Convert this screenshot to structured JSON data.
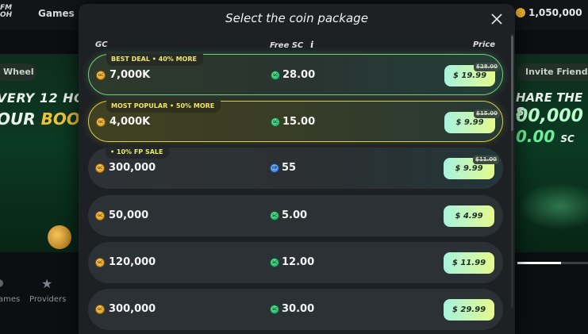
{
  "background": {
    "logo": "FM\nOH",
    "nav_games": "Games",
    "balance": "1,050,000",
    "wheel_pill": "Wheel",
    "left_line1": "VERY 12 HO",
    "left_line2a": "OUR ",
    "left_line2b": "BOOS",
    "invite_pill": "Invite Friends",
    "right_line1": "HARE THE S",
    "right_line2": "00,000",
    "right_line3": "0.00",
    "right_line3_unit": "SC",
    "bottom_games": "ames",
    "bottom_providers": "Providers"
  },
  "modal": {
    "title": "Select the coin package",
    "columns": {
      "gc": "GC",
      "free_sc": "Free SC",
      "price": "Price"
    },
    "packages": [
      {
        "badge": "BEST DEAL • 40% MORE",
        "gc": "7,000K",
        "bonus_type": "sc",
        "bonus": "28.00",
        "price": "$ 19.99",
        "old_price": "$28.00"
      },
      {
        "badge": "MOST POPULAR • 50% MORE",
        "gc": "4,000K",
        "bonus_type": "sc",
        "bonus": "15.00",
        "price": "$ 9.99",
        "old_price": "$15.00"
      },
      {
        "badge": "• 10% FP SALE",
        "gc": "300,000",
        "bonus_type": "fp",
        "bonus": "55",
        "price": "$ 9.99",
        "old_price": "$11.00"
      },
      {
        "badge": "",
        "gc": "50,000",
        "bonus_type": "sc",
        "bonus": "5.00",
        "price": "$ 4.99",
        "old_price": ""
      },
      {
        "badge": "",
        "gc": "120,000",
        "bonus_type": "sc",
        "bonus": "12.00",
        "price": "$ 11.99",
        "old_price": ""
      },
      {
        "badge": "",
        "gc": "300,000",
        "bonus_type": "sc",
        "bonus": "30.00",
        "price": "$ 29.99",
        "old_price": ""
      }
    ]
  },
  "icons": {
    "gc_coin": "GC",
    "sc_coin": "SC",
    "fp_coin": "FP"
  },
  "colors": {
    "best_border": "#6fd07c",
    "popular_border": "#d6d04a",
    "badge_text": "#f0e56b",
    "price_gradient_start": "#a7f3de",
    "price_gradient_end": "#e5f98b"
  }
}
